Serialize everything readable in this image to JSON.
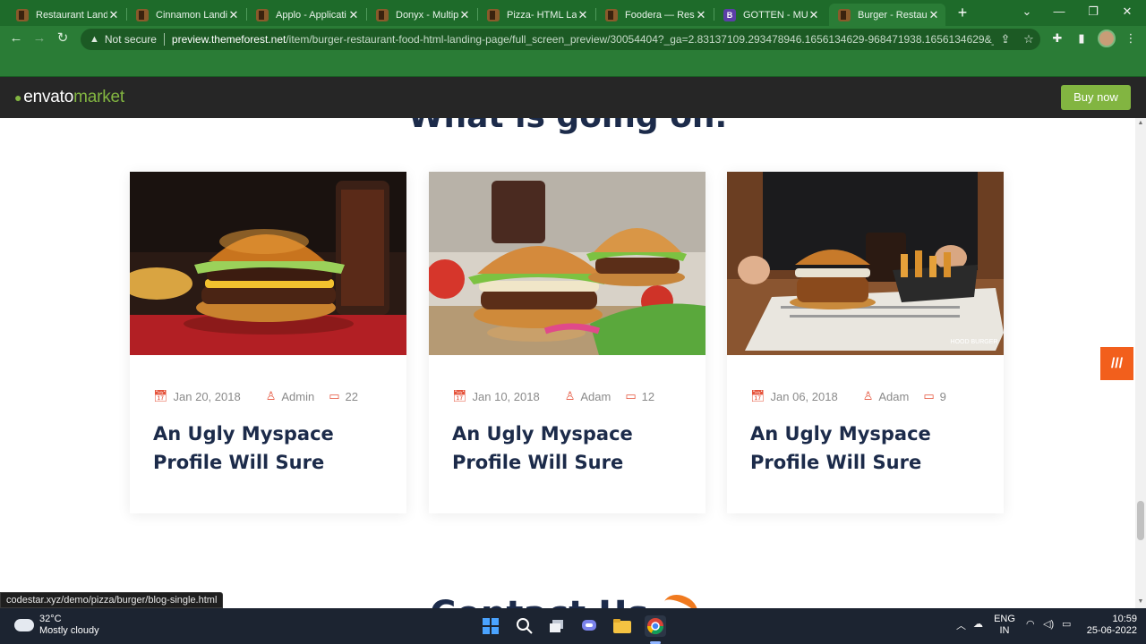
{
  "browser": {
    "tabs": [
      {
        "title": "Restaurant Landi",
        "favicon": "themeforest-icon"
      },
      {
        "title": "Cinnamon Landin",
        "favicon": "themeforest-icon"
      },
      {
        "title": "Applo - Applicati",
        "favicon": "themeforest-icon"
      },
      {
        "title": "Donyx - Multipur",
        "favicon": "themeforest-icon"
      },
      {
        "title": "Pizza- HTML Lanc",
        "favicon": "themeforest-icon"
      },
      {
        "title": "Foodera — Respo",
        "favicon": "themeforest-icon"
      },
      {
        "title": "GOTTEN - MULTIP",
        "favicon": "bootstrap-icon",
        "favicon_letter": "B"
      },
      {
        "title": "Burger - Restaura",
        "favicon": "themeforest-icon",
        "active": true
      }
    ],
    "not_secure": "Not secure",
    "url_host": "preview.themeforest.net",
    "url_path": "/item/burger-restaurant-food-html-landing-page/full_screen_preview/30054404?_ga=2.83137109.293478946.1656134629-968471938.1656134629&_ga...",
    "status_url": "codestar.xyz/demo/pizza/burger/blog-single.html"
  },
  "envato": {
    "logo_main": "envato",
    "logo_accent": "market",
    "buy_now": "Buy now",
    "brand_color": "#82b541"
  },
  "page": {
    "section_heading": "What is going on.",
    "next_heading": "Contact Us",
    "posts": [
      {
        "date": "Jan 20, 2018",
        "author": "Admin",
        "comments": "22",
        "title": "An Ugly Myspace Profile Will Sure"
      },
      {
        "date": "Jan 10, 2018",
        "author": "Adam",
        "comments": "12",
        "title": "An Ugly Myspace Profile Will Sure"
      },
      {
        "date": "Jan 06, 2018",
        "author": "Adam",
        "comments": "9",
        "title": "An Ugly Myspace Profile Will Sure"
      }
    ],
    "image_watermark": "HOOD BURGER",
    "accent_color": "#e5533b",
    "heading_color": "#1c2b4a"
  },
  "taskbar": {
    "temperature": "32°C",
    "weather": "Mostly cloudy",
    "lang_1": "ENG",
    "lang_2": "IN",
    "time": "10:59",
    "date": "25-06-2022"
  }
}
